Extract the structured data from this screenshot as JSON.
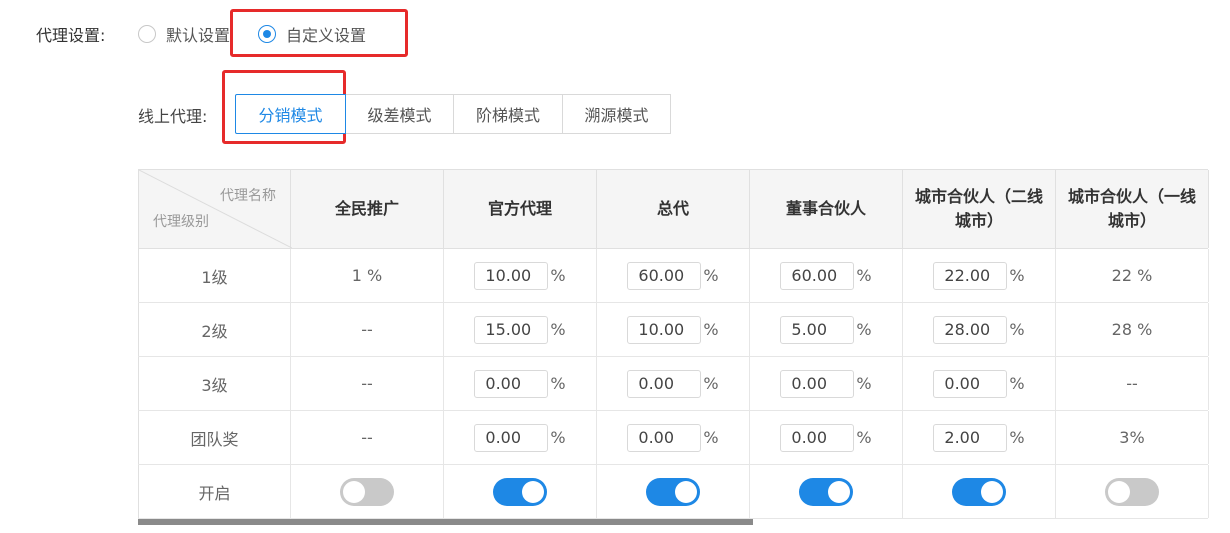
{
  "agent_setting": {
    "label": "代理设置:",
    "options": [
      "默认设置",
      "自定义设置"
    ],
    "selected": "自定义设置"
  },
  "online_agent": {
    "label": "线上代理:",
    "tabs": [
      "分销模式",
      "级差模式",
      "阶梯模式",
      "溯源模式"
    ],
    "active": "分销模式"
  },
  "table": {
    "corner_top": "代理名称",
    "corner_bottom": "代理级别",
    "columns": [
      "全民推广",
      "官方代理",
      "总代",
      "董事合伙人",
      "城市合伙人（二线城市）",
      "城市合伙人（一线城市）"
    ],
    "percent_sign": "%",
    "rows": [
      {
        "label": "1级",
        "cells": [
          {
            "type": "text",
            "value": "1 %"
          },
          {
            "type": "input",
            "value": "10.00"
          },
          {
            "type": "input",
            "value": "60.00"
          },
          {
            "type": "input",
            "value": "60.00"
          },
          {
            "type": "input",
            "value": "22.00"
          },
          {
            "type": "text",
            "value": "22 %"
          }
        ]
      },
      {
        "label": "2级",
        "cells": [
          {
            "type": "text",
            "value": "--"
          },
          {
            "type": "input",
            "value": "15.00"
          },
          {
            "type": "input",
            "value": "10.00"
          },
          {
            "type": "input",
            "value": "5.00"
          },
          {
            "type": "input",
            "value": "28.00"
          },
          {
            "type": "text",
            "value": "28 %"
          }
        ]
      },
      {
        "label": "3级",
        "cells": [
          {
            "type": "text",
            "value": "--"
          },
          {
            "type": "input",
            "value": "0.00"
          },
          {
            "type": "input",
            "value": "0.00"
          },
          {
            "type": "input",
            "value": "0.00"
          },
          {
            "type": "input",
            "value": "0.00"
          },
          {
            "type": "text",
            "value": "--"
          }
        ]
      },
      {
        "label": "团队奖",
        "cells": [
          {
            "type": "text",
            "value": "--"
          },
          {
            "type": "input",
            "value": "0.00"
          },
          {
            "type": "input",
            "value": "0.00"
          },
          {
            "type": "input",
            "value": "0.00"
          },
          {
            "type": "input",
            "value": "2.00"
          },
          {
            "type": "text",
            "value": "3%"
          }
        ]
      }
    ],
    "toggle_row": {
      "label": "开启",
      "states": [
        false,
        true,
        true,
        true,
        true,
        false
      ]
    }
  },
  "colors": {
    "accent": "#1e88e5",
    "highlight_box": "#e62a2a",
    "toggle_off": "#c9c9c9",
    "header_bg": "#f5f5f5"
  }
}
